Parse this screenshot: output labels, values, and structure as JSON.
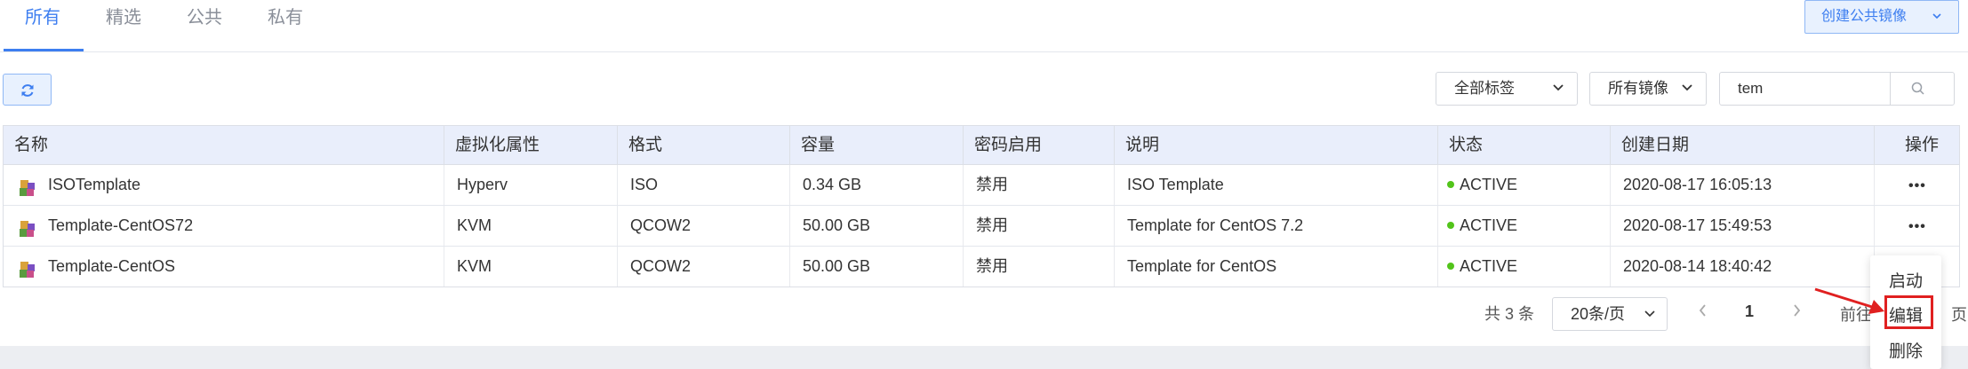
{
  "tabs": [
    "所有",
    "精选",
    "公共",
    "私有"
  ],
  "create_button": {
    "label": "创建公共镜像",
    "icon": "chevron-down-icon"
  },
  "toolbar": {
    "refresh_icon": "refresh-icon",
    "tag_filter": "全部标签",
    "image_filter": "所有镜像",
    "search_value": "tem",
    "search_icon": "search-icon"
  },
  "table": {
    "headers": [
      "名称",
      "虚拟化属性",
      "格式",
      "容量",
      "密码启用",
      "说明",
      "状态",
      "创建日期",
      "操作"
    ],
    "rows": [
      {
        "name": "ISOTemplate",
        "virt": "Hyperv",
        "format": "ISO",
        "size": "0.34 GB",
        "password": "禁用",
        "desc": "ISO Template",
        "status": "ACTIVE",
        "date": "2020-08-17 16:05:13",
        "action": "•••"
      },
      {
        "name": "Template-CentOS72",
        "virt": "KVM",
        "format": "QCOW2",
        "size": "50.00 GB",
        "password": "禁用",
        "desc": "Template for CentOS 7.2",
        "status": "ACTIVE",
        "date": "2020-08-17 15:49:53",
        "action": "•••"
      },
      {
        "name": "Template-CentOS",
        "virt": "KVM",
        "format": "QCOW2",
        "size": "50.00 GB",
        "password": "禁用",
        "desc": "Template for CentOS",
        "status": "ACTIVE",
        "date": "2020-08-14 18:40:42",
        "action": ""
      }
    ]
  },
  "pagination": {
    "total": "共 3 条",
    "page_size": "20条/页",
    "current_page": "1",
    "goto_prefix": "前往",
    "goto_suffix": "页"
  },
  "action_menu": [
    "启动",
    "编辑",
    "删除"
  ],
  "colors": {
    "accent": "#3d7ef0",
    "status_active": "#52c41a",
    "highlight": "#e02020"
  }
}
